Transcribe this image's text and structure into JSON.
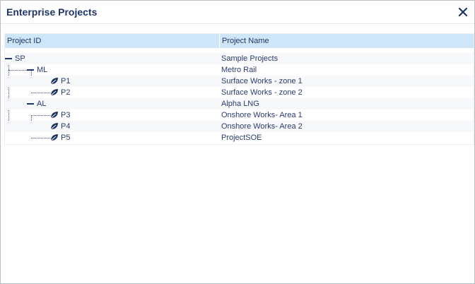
{
  "dialog": {
    "title": "Enterprise Projects",
    "close_icon": "close-icon"
  },
  "columns": {
    "project_id": "Project ID",
    "project_name": "Project Name"
  },
  "rows": [
    {
      "id": "SP",
      "name": "Sample Projects",
      "level": 0,
      "node": "collapse-minus-icon"
    },
    {
      "id": "ML",
      "name": "Metro Rail",
      "level": 1,
      "node": "collapse-minus-icon"
    },
    {
      "id": "P1",
      "name": "Surface Works - zone 1",
      "level": 2,
      "node": "leaf-icon"
    },
    {
      "id": "P2",
      "name": "Surface Works - zone 2",
      "level": 2,
      "node": "leaf-icon"
    },
    {
      "id": "AL",
      "name": "Alpha LNG",
      "level": 1,
      "node": "collapse-minus-icon"
    },
    {
      "id": "P3",
      "name": "Onshore Works- Area 1",
      "level": 2,
      "node": "leaf-icon"
    },
    {
      "id": "P4",
      "name": "Onshore Works- Area 2",
      "level": 2,
      "node": "leaf-icon"
    },
    {
      "id": "P5",
      "name": "ProjectSOE",
      "level": 2,
      "node": "leaf-icon"
    }
  ],
  "colors": {
    "header_bg": "#cfe6f8",
    "title": "#1e3566",
    "leaf": "#1e3566"
  }
}
